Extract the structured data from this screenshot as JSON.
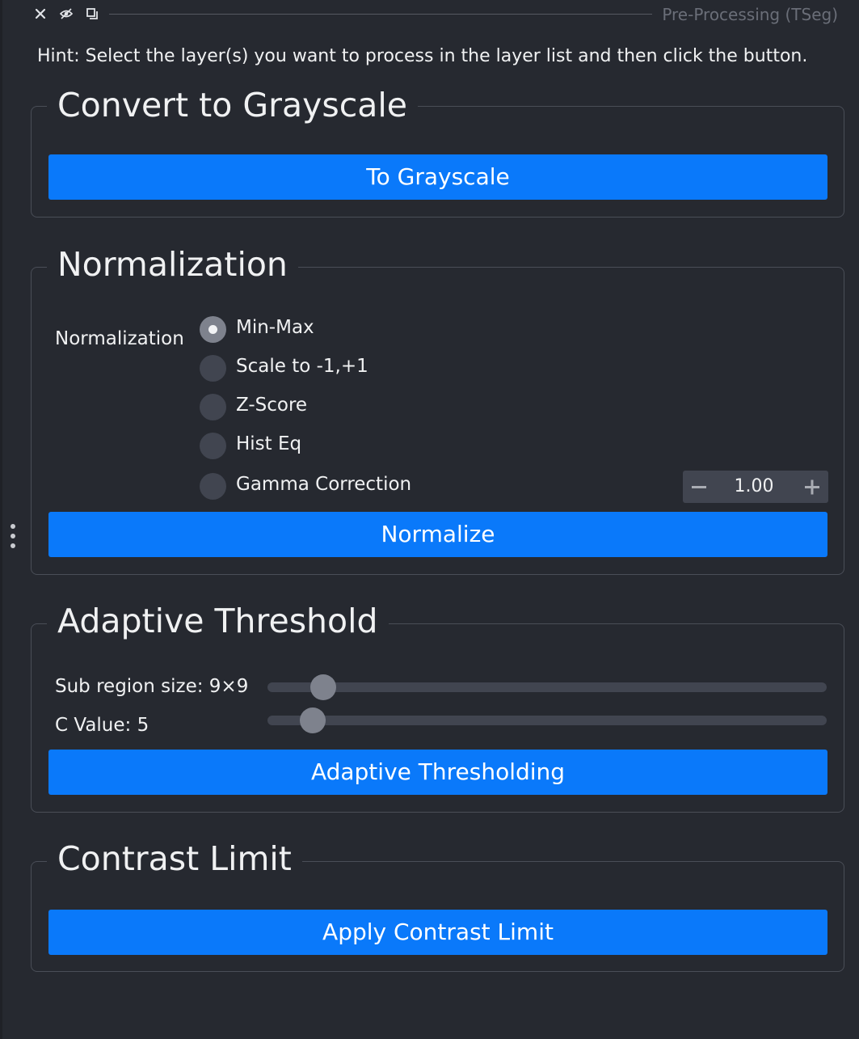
{
  "window": {
    "title": "Pre-Processing (TSeg)",
    "icons": [
      "close-icon",
      "visibility-icon",
      "float-icon"
    ]
  },
  "hint": "Hint: Select the layer(s) you want to process in the layer list and then click the button.",
  "grayscale": {
    "title": "Convert to Grayscale",
    "button": "To Grayscale"
  },
  "normalization": {
    "title": "Normalization",
    "label": "Normalization",
    "options": [
      {
        "label": "Min-Max",
        "checked": true
      },
      {
        "label": "Scale to -1,+1",
        "checked": false
      },
      {
        "label": "Z-Score",
        "checked": false
      },
      {
        "label": "Hist Eq",
        "checked": false
      },
      {
        "label": "Gamma Correction",
        "checked": false
      }
    ],
    "gamma_value": "1.00",
    "button": "Normalize"
  },
  "adaptive": {
    "title": "Adaptive Threshold",
    "sub_region_label": "Sub region size: 9×9",
    "sub_region_fraction": 0.08,
    "c_value_label": "C Value: 5",
    "c_value_fraction": 0.06,
    "button": "Adaptive Thresholding"
  },
  "contrast": {
    "title": "Contrast Limit",
    "button": "Apply Contrast Limit"
  },
  "colors": {
    "background": "#262930",
    "button": "#0a79fa",
    "control": "#414550",
    "handle": "#7e828d"
  }
}
